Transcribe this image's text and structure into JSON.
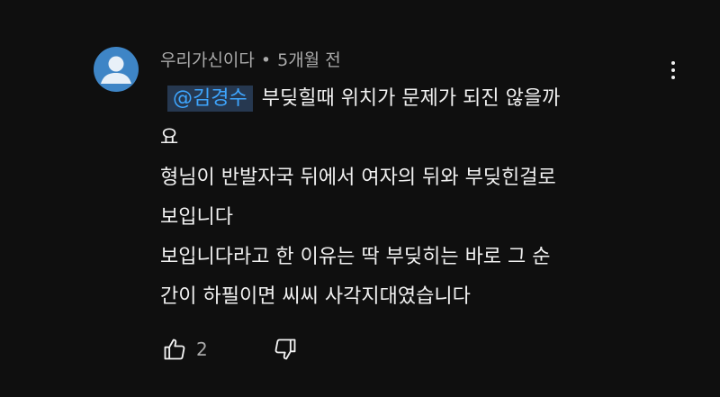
{
  "comment": {
    "author": "우리가신이다",
    "separator": "•",
    "time": "5개월 전",
    "mention": "@김경수",
    "lines": [
      "부딪힐때 위치가 문제가 되진 않을까",
      "요",
      "형님이 반발자국 뒤에서 여자의 뒤와 부딪힌걸로",
      "보입니다",
      "보입니다라고 한 이유는 딱 부딪히는 바로 그 순",
      "간이 하필이면 씨씨 사각지대였습니다"
    ],
    "like_count": "2"
  },
  "icons": {
    "avatar": "default-user-avatar",
    "more": "three-dots-vertical",
    "like": "thumbs-up",
    "dislike": "thumbs-down"
  },
  "colors": {
    "background": "#0f0f0f",
    "text": "#f1f1f1",
    "secondary_text": "#aaaaaa",
    "mention_text": "#3ea6ff",
    "mention_bg": "#263850",
    "avatar_bg": "#3e85c6"
  }
}
